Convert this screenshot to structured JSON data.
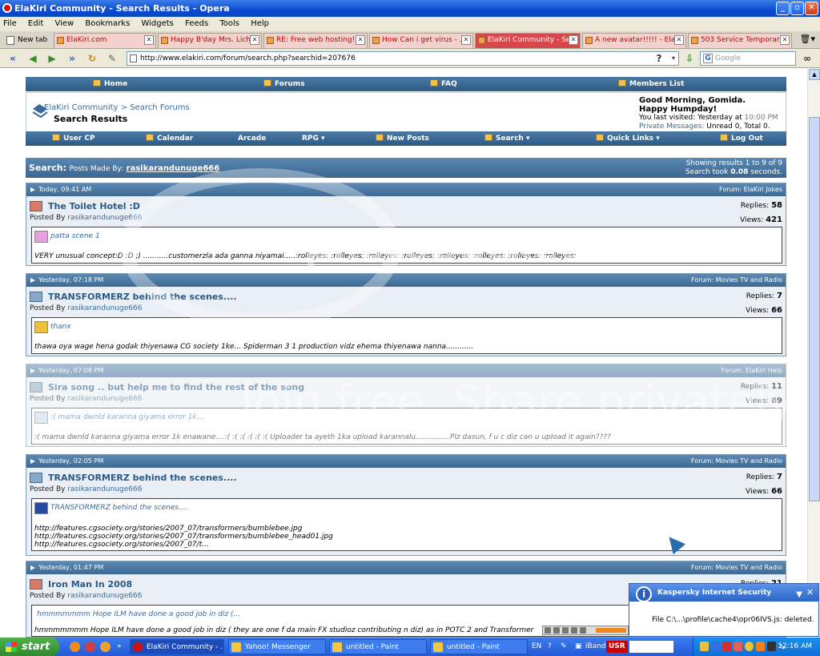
{
  "window": {
    "title": "ElaKiri Community - Search Results - Opera"
  },
  "menu": [
    "File",
    "Edit",
    "View",
    "Bookmarks",
    "Widgets",
    "Feeds",
    "Tools",
    "Help"
  ],
  "tabs": {
    "new_tab": "New tab",
    "items": [
      {
        "label": "ElaKiri.com",
        "active": false
      },
      {
        "label": "Happy B'day Mrs. Lich ...",
        "active": false
      },
      {
        "label": "RE: Free web hosting!...",
        "active": false
      },
      {
        "label": "How Can i get virus - ...",
        "active": false
      },
      {
        "label": "ElaKiri Community - Se...",
        "active": true
      },
      {
        "label": "A new avatar!!!!! - Ela...",
        "active": false
      },
      {
        "label": "503 Service Temporaril...",
        "active": false
      }
    ]
  },
  "address": {
    "url": "http://www.elakiri.com/forum/search.php?searchid=207676",
    "search_placeholder": "Google"
  },
  "forum": {
    "topnav": [
      "Home",
      "Forums",
      "FAQ",
      "Members List"
    ],
    "breadcrumb": "ElaKiri Community",
    "breadcrumb_sep": ">",
    "breadcrumb_link": "Search Forums",
    "page_title": "Search Results",
    "welcome": {
      "greeting": "Good Morning, Gomida.",
      "day": "Happy Humpday!",
      "last_visit_label": "You last visited: Yesterday at",
      "last_visit_time": "10:00 PM",
      "pm_label": "Private Messages:",
      "pm_value": "Unread 0, Total 0."
    },
    "subnav": [
      "User CP",
      "Calendar",
      "Arcade",
      "RPG",
      "New Posts",
      "Search",
      "Quick Links",
      "Log Out"
    ],
    "search": {
      "label": "Search:",
      "made_by": "Posts Made By:",
      "user": "rasikarandunuge666",
      "showing": "Showing results 1 to 9 of 9",
      "took_label": "Search took",
      "took_value": "0.08",
      "took_unit": "seconds."
    },
    "posts": [
      {
        "date": "Today, 09:41 AM",
        "forum": "Forum: ElaKiri Jokes",
        "title": "The Toilet Hotel :D",
        "posted_by": "Posted By",
        "user": "rasikarandunuge666",
        "replies_label": "Replies:",
        "replies": "58",
        "views_label": "Views:",
        "views": "421",
        "snippet": "patta scene 1",
        "text": "VERY unusual concept:D :D ;) ...........customerzla ada ganna niyamai.....:rolleyes: :rolleyes: :rolleyes: :rolleyes: :rolleyes: :rolleyes: :rolleyes: :rolleyes:"
      },
      {
        "date": "Yesterday, 07:18 PM",
        "forum": "Forum: Movies TV and Radio",
        "title": "TRANSFORMERZ behind the scenes....",
        "posted_by": "Posted By",
        "user": "rasikarandunuge666",
        "replies_label": "Replies:",
        "replies": "7",
        "views_label": "Views:",
        "views": "66",
        "snippet": "thanx",
        "text": "thawa oya wage hena godak thiyenawa CG society 1ke... Spiderman 3 1 production vidz ehema thiyenawa nanna............"
      },
      {
        "date": "Yesterday, 07:08 PM",
        "forum": "Forum: ElaKiri Help",
        "title": "Sira song .. but help me to find the rest of the song",
        "posted_by": "Posted By",
        "user": "rasikarandunuge666",
        "replies_label": "Replies:",
        "replies": "11",
        "views_label": "Views:",
        "views": "89",
        "snippet": ":( mama dwnld karanna giyama error 1k...",
        "text": ":( mama dwnld karanna giyama error 1k enawane....:( :( :( :( :( :( Uploader ta ayeth 1ka upload karannalu...............Plz dasun, f u c diz can u upload it again????"
      },
      {
        "date": "Yesterday, 02:05 PM",
        "forum": "Forum: Movies TV and Radio",
        "title": "TRANSFORMERZ behind the scenes....",
        "posted_by": "Posted By",
        "user": "rasikarandunuge666",
        "replies_label": "Replies:",
        "replies": "7",
        "views_label": "Views:",
        "views": "66",
        "snippet": "TRANSFORMERZ behind the scenes....",
        "text": "http://features.cgsociety.org/stories/2007_07/transformers/bumblebee.jpg\nhttp://features.cgsociety.org/stories/2007_07/transformers/bumblebee_head01.jpg\nhttp://features.cgsociety.org/stories/2007_07/t..."
      },
      {
        "date": "Yesterday, 01:47 PM",
        "forum": "Forum: Movies TV and Radio",
        "title": "Iron Man In 2008",
        "posted_by": "Posted By",
        "user": "rasikarandunuge666",
        "replies_label": "Replies:",
        "replies": "21",
        "views_label": "Views:",
        "views": "",
        "snippet": "hmmmmmmm Hope ILM have done a good job in diz (...",
        "text": "hmmmmmmm Hope ILM have done a good job in diz ( they are one f da main FX studioz contributing n diz) as in POTC 2 and Transformer"
      }
    ]
  },
  "popup": {
    "title": "Kaspersky Internet Security",
    "message": "File C:\\...\\profile\\cache4\\opr06IVS.js: deleted."
  },
  "watermark": {
    "brand": "photobucket",
    "tagline": "Join free. Share privately."
  },
  "taskbar": {
    "start": "start",
    "items": [
      "ElaKiri Community - ...",
      "Yahoo! Messenger",
      "untitled - Paint",
      "untitled - Paint"
    ],
    "lang": "EN",
    "iband": "iBand",
    "usr": "USR",
    "clock": "12:16 AM"
  },
  "colors": {
    "titlebar": "#0b4bd0",
    "forum_header": "#2d5a85",
    "post_border": "#7a9ab8",
    "link": "#2c5a86"
  }
}
